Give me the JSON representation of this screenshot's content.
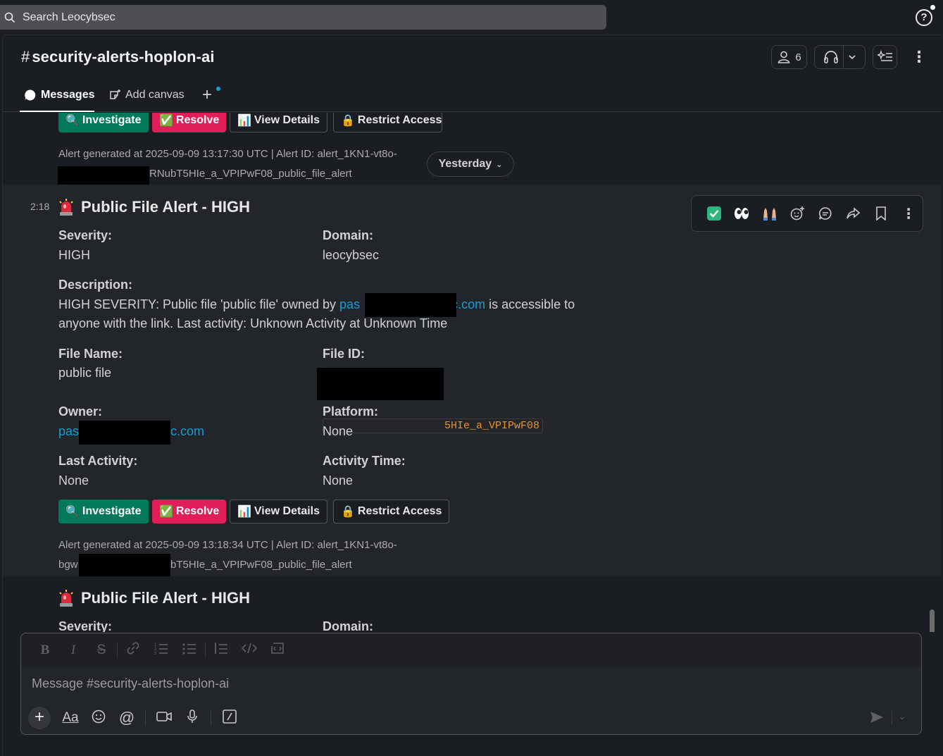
{
  "search": {
    "placeholder": "Search Leocybsec"
  },
  "header": {
    "channel_hash": "#",
    "channel_name": "security-alerts-hoplon-ai",
    "member_count": "6"
  },
  "tabs": [
    {
      "label": "Messages"
    },
    {
      "label": "Add canvas"
    }
  ],
  "day_divider": {
    "label": "Yesterday"
  },
  "alert_prev": {
    "buttons": {
      "investigate": "Investigate",
      "resolve": "Resolve",
      "view_details": "View Details",
      "restrict_access": "Restrict Access"
    },
    "footer_line1": "Alert generated at 2025-09-09 13:17:30 UTC | Alert ID: alert_1KN1-vt8o-",
    "footer_line2_tail": "RNubT5HIe_a_VPIPwF08_public_file_alert"
  },
  "alert_main": {
    "time": "2:18",
    "title": "Public File Alert - HIGH",
    "severity_label": "Severity:",
    "severity_value": "HIGH",
    "domain_label": "Domain:",
    "domain_value": "leocybsec",
    "description_label": "Description:",
    "description_pre": "HIGH SEVERITY: Public file 'public file' owned by ",
    "description_email_head": "pas",
    "description_email_tail": "c.com",
    "description_post": " is accessible to",
    "description_line2": "anyone with the link. Last activity: Unknown Activity at Unknown Time",
    "file_name_label": "File Name:",
    "file_name_value": "public file",
    "file_id_label": "File ID:",
    "file_id_tail": "5HIe_a_VPIPwF08",
    "owner_label": "Owner:",
    "owner_head": "pas",
    "owner_tail": "c.com",
    "platform_label": "Platform:",
    "platform_value": "None",
    "last_activity_label": "Last Activity:",
    "last_activity_value": "None",
    "activity_time_label": "Activity Time:",
    "activity_time_value": "None",
    "buttons": {
      "investigate": "Investigate",
      "resolve": "Resolve",
      "view_details": "View Details",
      "restrict_access": "Restrict Access"
    },
    "footer_line1": "Alert generated at 2025-09-09 13:18:34 UTC | Alert ID: alert_1KN1-vt8o-",
    "footer_line2_head": "bgw",
    "footer_line2_tail": "bT5HIe_a_VPIPwF08_public_file_alert"
  },
  "alert_next": {
    "title": "Public File Alert - HIGH",
    "severity_label": "Severity:",
    "domain_label": "Domain:"
  },
  "composer": {
    "placeholder": "Message #security-alerts-hoplon-ai"
  },
  "hover_actions": [
    "check-reaction",
    "eyes-reaction",
    "raised-hands-reaction",
    "add-reaction",
    "reply-in-thread",
    "forward",
    "save",
    "more-actions"
  ],
  "colors": {
    "investigate": "#007a5a",
    "resolve": "#e01e5a",
    "link": "#1d9bd1",
    "code": "#e8912d"
  }
}
